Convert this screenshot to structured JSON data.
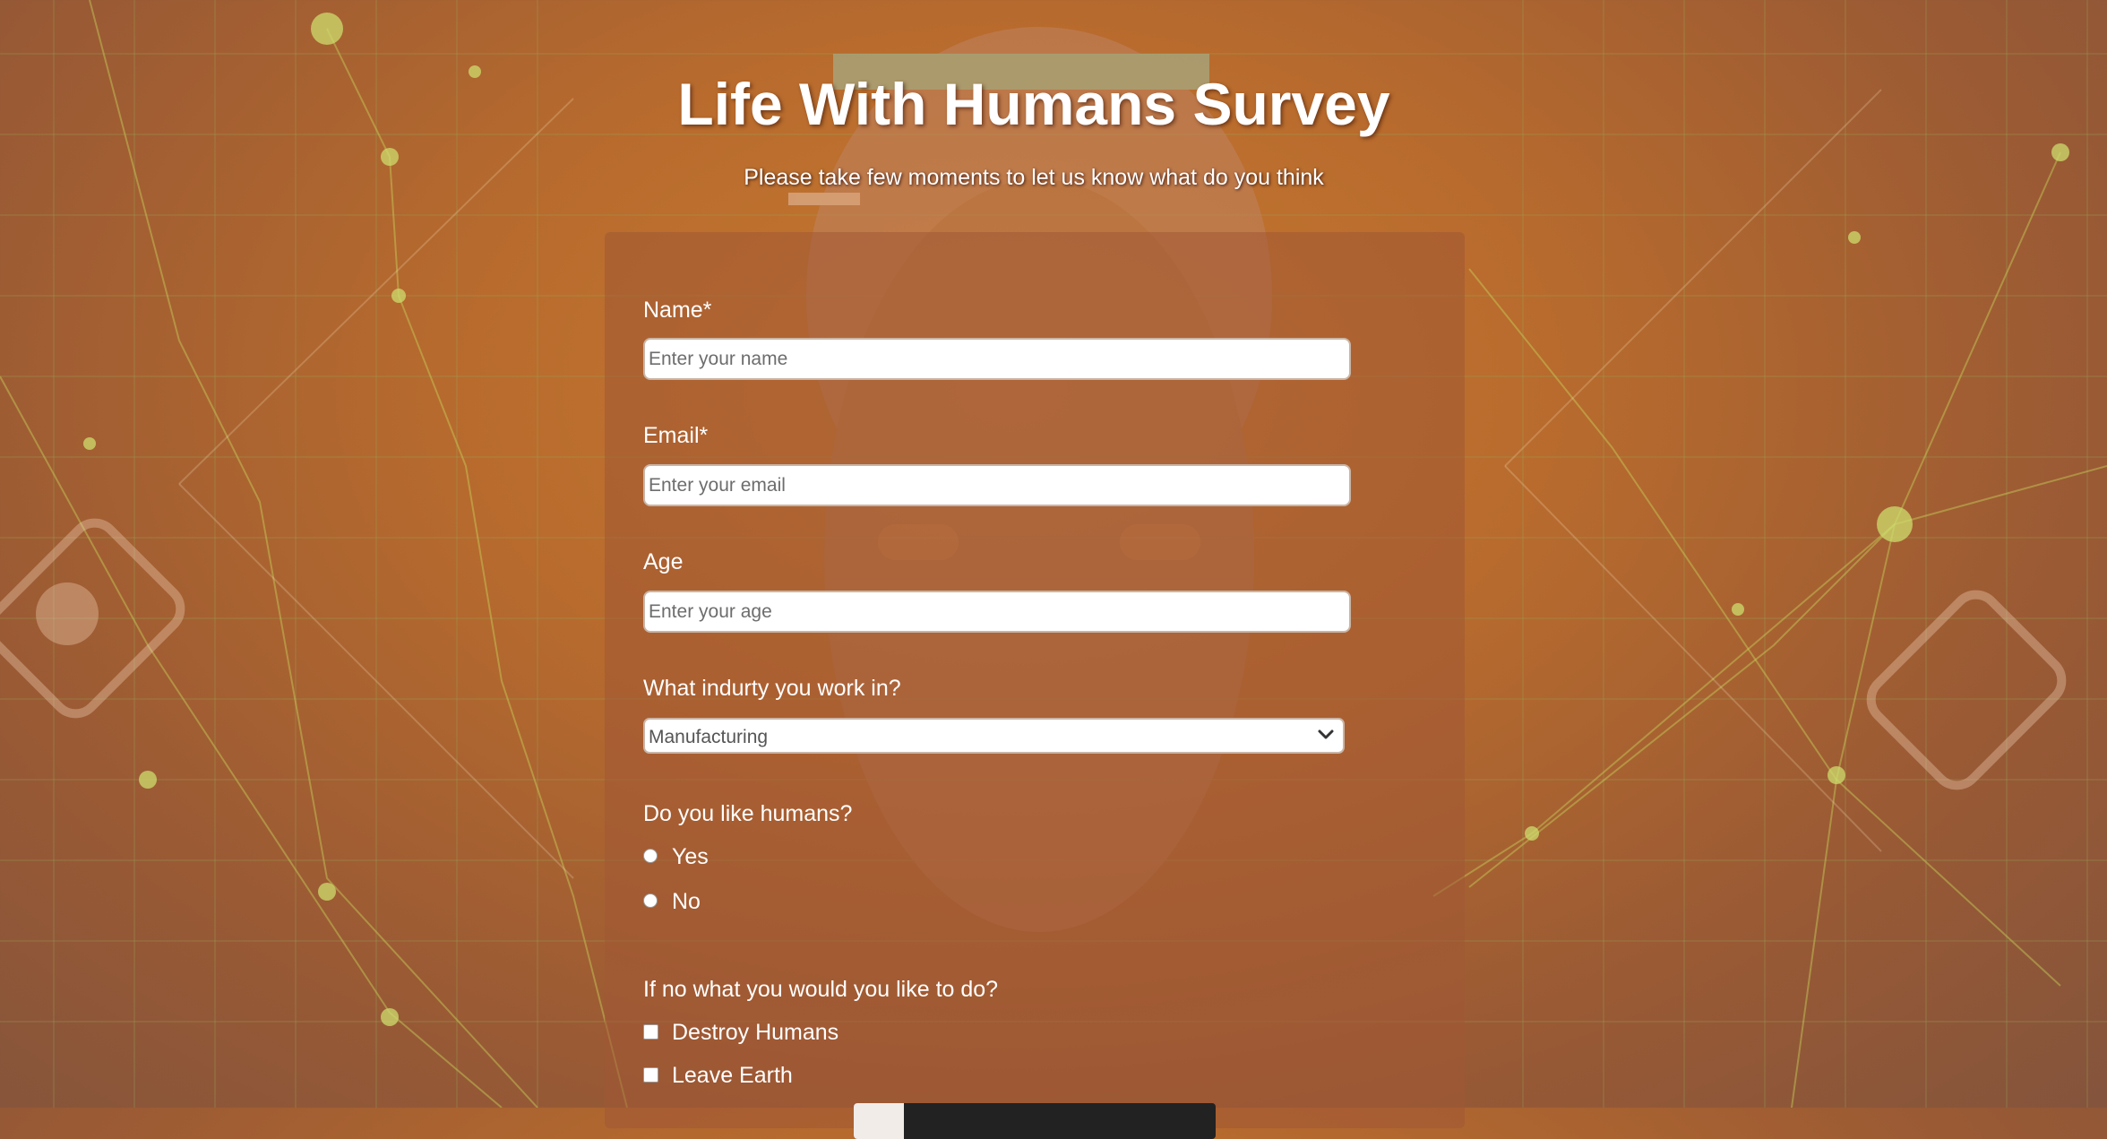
{
  "header": {
    "title": "Life With Humans Survey",
    "subtitle": "Please take few moments to let us know what do you think"
  },
  "form": {
    "name": {
      "label": "Name*",
      "placeholder": "Enter your name",
      "value": ""
    },
    "email": {
      "label": "Email*",
      "placeholder": "Enter your email",
      "value": ""
    },
    "age": {
      "label": "Age",
      "placeholder": "Enter your age",
      "value": ""
    },
    "industry": {
      "label": "What indurty you work in?",
      "selected": "Manufacturing"
    },
    "like_humans": {
      "question": "Do you like humans?",
      "options": [
        "Yes",
        "No"
      ]
    },
    "if_no": {
      "question": "If no what you would you like to do?",
      "options": [
        "Destroy Humans",
        "Leave Earth"
      ]
    }
  },
  "theme": {
    "background": "#b86b2d",
    "card": "rgba(160, 88, 52, 0.55)",
    "text": "#ffffff"
  },
  "icons": [
    "chevron-down-icon"
  ]
}
